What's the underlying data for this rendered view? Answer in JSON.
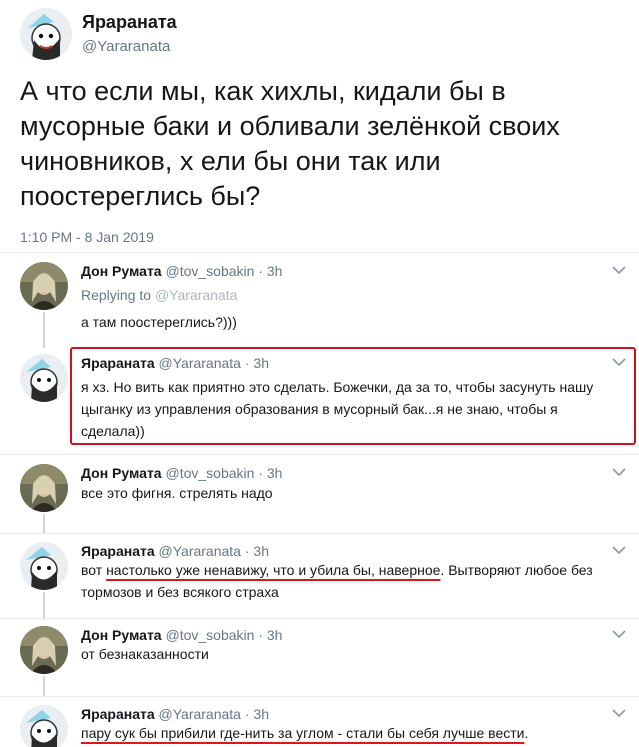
{
  "main_tweet": {
    "author_name": "Ярараната",
    "author_handle": "@Yararanata",
    "text": "А что если мы, как хихлы, кидали бы в мусорные баки и обливали зелёнкой своих чиновников, х ели бы они так или поостереглись бы?",
    "timestamp": "1:10 PM - 8 Jan 2019"
  },
  "replies": [
    {
      "name": "Дон Румата",
      "handle": "@tov_sobakin",
      "time": "3h",
      "replying_prefix": "Replying to",
      "replying_handle": "@Yararanata",
      "text": "а там поостереглись?)))"
    },
    {
      "name": "Ярараната",
      "handle": "@Yararanata",
      "time": "3h",
      "text": "я хз. Но вить как приятно это сделать. Божечки, да за то, чтобы засунуть нашу цыганку из управления образования в мусорный бак...я не знаю, чтобы я сделала))"
    },
    {
      "name": "Дон Румата",
      "handle": "@tov_sobakin",
      "time": "3h",
      "text": "все это фигня. стрелять надо"
    },
    {
      "name": "Ярараната",
      "handle": "@Yararanata",
      "time": "3h",
      "text_before": "вот ",
      "text_underlined": "настолько уже ненавижу, что и убила бы, наверное",
      "text_after": ". Вытворяют любое без тормозов и без всякого страха"
    },
    {
      "name": "Дон Румата",
      "handle": "@tov_sobakin",
      "time": "3h",
      "text": "от безнаказанности"
    },
    {
      "name": "Ярараната",
      "handle": "@Yararanata",
      "time": "3h",
      "text_underlined": "пару сук бы прибили где-нить за углом - стали бы себя лучше вести",
      "text_after": "."
    }
  ],
  "separator_dot": "·",
  "colors": {
    "secondary_text": "#657786",
    "thread_line": "#ccd6dd",
    "highlight": "#d0101a"
  },
  "icons": [
    "chevron-down-icon"
  ]
}
